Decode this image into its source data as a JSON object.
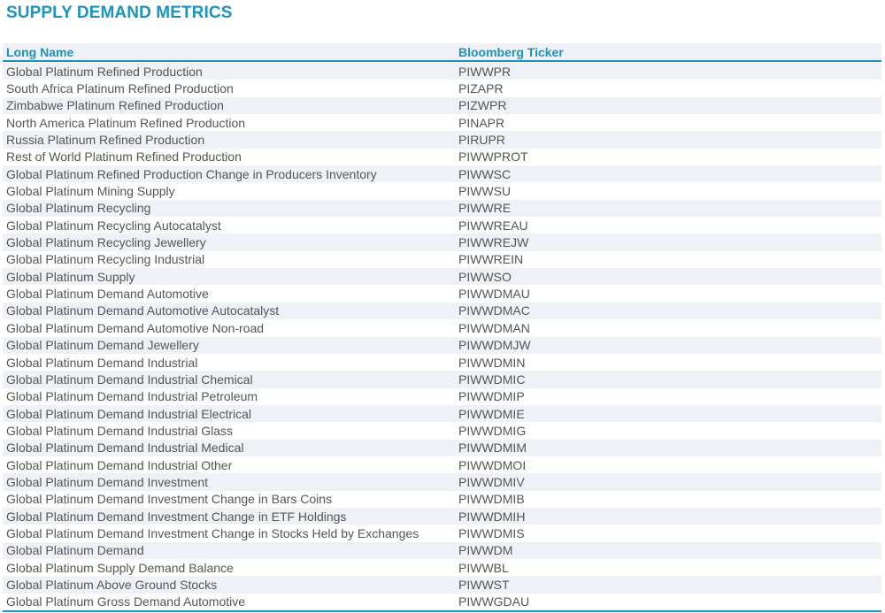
{
  "title": "SUPPLY DEMAND METRICS",
  "table": {
    "headers": {
      "long_name": "Long Name",
      "ticker": "Bloomberg Ticker"
    },
    "rows": [
      {
        "name": "Global Platinum Refined Production",
        "ticker": "PIWWPR"
      },
      {
        "name": "South Africa Platinum Refined Production",
        "ticker": "PIZAPR"
      },
      {
        "name": "Zimbabwe Platinum Refined Production",
        "ticker": "PIZWPR"
      },
      {
        "name": "North America Platinum Refined Production",
        "ticker": "PINAPR"
      },
      {
        "name": "Russia Platinum Refined Production",
        "ticker": "PIRUPR"
      },
      {
        "name": "Rest of World Platinum Refined Production",
        "ticker": "PIWWPROT"
      },
      {
        "name": "Global Platinum Refined Production Change in Producers Inventory",
        "ticker": "PIWWSC"
      },
      {
        "name": "Global Platinum Mining Supply",
        "ticker": "PIWWSU"
      },
      {
        "name": "Global Platinum Recycling",
        "ticker": "PIWWRE"
      },
      {
        "name": "Global Platinum Recycling Autocatalyst",
        "ticker": "PIWWREAU"
      },
      {
        "name": "Global Platinum Recycling Jewellery",
        "ticker": "PIWWREJW"
      },
      {
        "name": "Global Platinum Recycling Industrial",
        "ticker": "PIWWREIN"
      },
      {
        "name": "Global Platinum Supply",
        "ticker": "PIWWSO"
      },
      {
        "name": "Global Platinum Demand Automotive",
        "ticker": "PIWWDMAU"
      },
      {
        "name": "Global Platinum Demand Automotive Autocatalyst",
        "ticker": "PIWWDMAC"
      },
      {
        "name": "Global Platinum Demand Automotive Non-road",
        "ticker": "PIWWDMAN"
      },
      {
        "name": "Global Platinum Demand Jewellery",
        "ticker": "PIWWDMJW"
      },
      {
        "name": "Global Platinum Demand Industrial",
        "ticker": "PIWWDMIN"
      },
      {
        "name": "Global Platinum Demand Industrial Chemical",
        "ticker": "PIWWDMIC"
      },
      {
        "name": "Global Platinum Demand Industrial Petroleum",
        "ticker": "PIWWDMIP"
      },
      {
        "name": "Global Platinum Demand Industrial Electrical",
        "ticker": "PIWWDMIE"
      },
      {
        "name": "Global Platinum Demand Industrial Glass",
        "ticker": "PIWWDMIG"
      },
      {
        "name": "Global Platinum Demand Industrial Medical",
        "ticker": "PIWWDMIM"
      },
      {
        "name": "Global Platinum Demand Industrial Other",
        "ticker": "PIWWDMOI"
      },
      {
        "name": "Global Platinum Demand Investment",
        "ticker": "PIWWDMIV"
      },
      {
        "name": "Global Platinum Demand Investment Change in Bars Coins",
        "ticker": "PIWWDMIB"
      },
      {
        "name": "Global Platinum Demand Investment Change in ETF Holdings",
        "ticker": "PIWWDMIH"
      },
      {
        "name": "Global Platinum Demand Investment Change in Stocks Held by Exchanges",
        "ticker": "PIWWDMIS"
      },
      {
        "name": "Global Platinum Demand",
        "ticker": "PIWWDM"
      },
      {
        "name": "Global Platinum Supply Demand Balance",
        "ticker": "PIWWBL"
      },
      {
        "name": "Global Platinum Above Ground Stocks",
        "ticker": "PIWWST"
      },
      {
        "name": "Global Platinum Gross Demand Automotive",
        "ticker": "PIWWGDAU"
      }
    ]
  }
}
